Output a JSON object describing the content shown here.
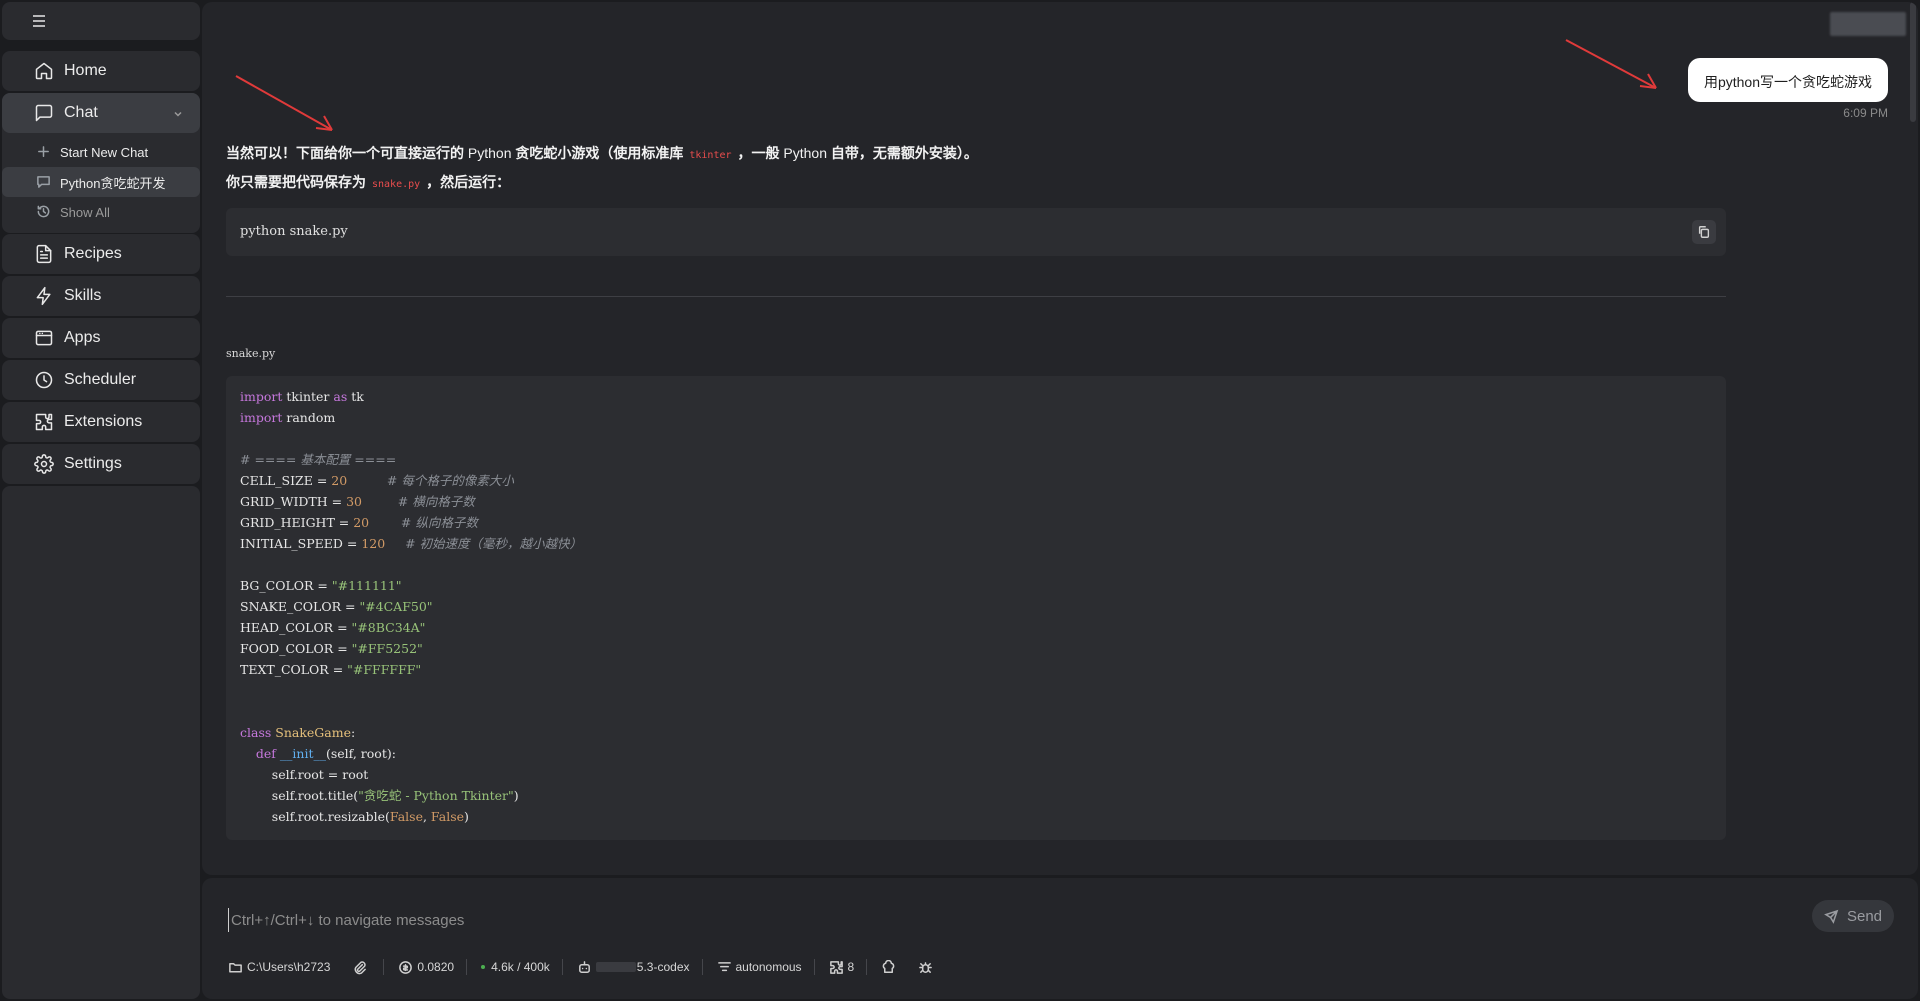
{
  "sidebar": {
    "items": [
      {
        "label": "Home",
        "icon": "home-icon"
      },
      {
        "label": "Chat",
        "icon": "chat-icon"
      },
      {
        "label": "Recipes",
        "icon": "recipes-icon"
      },
      {
        "label": "Skills",
        "icon": "bolt-icon"
      },
      {
        "label": "Apps",
        "icon": "apps-icon"
      },
      {
        "label": "Scheduler",
        "icon": "clock-icon"
      },
      {
        "label": "Extensions",
        "icon": "puzzle-icon"
      },
      {
        "label": "Settings",
        "icon": "gear-icon"
      }
    ],
    "chat_sub": {
      "new_chat": "Start New Chat",
      "current": "Python贪吃蛇开发",
      "show_all": "Show All"
    }
  },
  "conversation": {
    "user_message": "用python写一个贪吃蛇游戏",
    "user_time": "6:09 PM",
    "intro_a": "当然可以！下面给你一个可直接运行的 ",
    "intro_b": "Python",
    "intro_c": " 贪吃蛇小游戏（使用标准库",
    "intro_code": "tkinter",
    "intro_d": "，一般 ",
    "intro_e": "Python",
    "intro_f": " 自带，无需额外安装）。",
    "save_a": "你只需要把代码保存为",
    "save_code": "snake.py",
    "save_b": "，然后运行：",
    "run_command": "python snake.py",
    "filename": "snake.py",
    "code": {
      "l1": [
        "import",
        " tkinter ",
        "as",
        " tk"
      ],
      "l2": [
        "import",
        " random"
      ],
      "l4": "# ==== 基本配置 ====",
      "l5": [
        "CELL_SIZE",
        " = ",
        "20",
        "          ",
        "# 每个格子的像素大小"
      ],
      "l6": [
        "GRID_WIDTH",
        " = ",
        "30",
        "         ",
        "# 横向格子数"
      ],
      "l7": [
        "GRID_HEIGHT",
        " = ",
        "20",
        "        ",
        "# 纵向格子数"
      ],
      "l8": [
        "INITIAL_SPEED",
        " = ",
        "120",
        "     ",
        "# 初始速度（毫秒，越小越快）"
      ],
      "l10": [
        "BG_COLOR",
        " = ",
        "\"#111111\""
      ],
      "l11": [
        "SNAKE_COLOR",
        " = ",
        "\"#4CAF50\""
      ],
      "l12": [
        "HEAD_COLOR",
        " = ",
        "\"#8BC34A\""
      ],
      "l13": [
        "FOOD_COLOR",
        " = ",
        "\"#FF5252\""
      ],
      "l14": [
        "TEXT_COLOR",
        " = ",
        "\"#FFFFFF\""
      ],
      "l17": [
        "class",
        " SnakeGame",
        ":"
      ],
      "l18": [
        "    ",
        "def",
        " __init__",
        "(self, root):"
      ],
      "l19": "        self.root = root",
      "l20": [
        "        self.root.title(",
        "\"贪吃蛇 - Python Tkinter\"",
        ")"
      ],
      "l21": [
        "        self.root.resizable(",
        "False",
        ", ",
        "False",
        ")"
      ]
    }
  },
  "composer": {
    "placeholder": "Ctrl+↑/Ctrl+↓ to navigate messages",
    "send_label": "Send",
    "path": "C:\\Users\\h2723",
    "cost": "0.0820",
    "tokens": "4.6k / 400k",
    "model": "5.3-codex",
    "mode": "autonomous",
    "extensions_count": "8"
  }
}
